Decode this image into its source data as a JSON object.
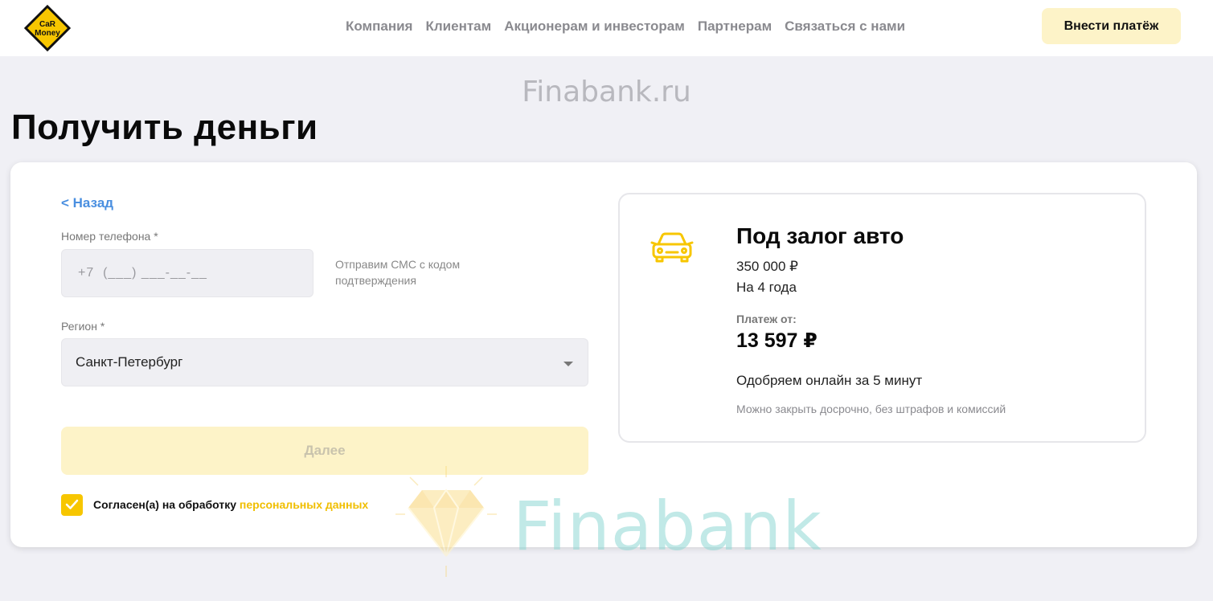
{
  "header": {
    "logo_text_line1": "CaR",
    "logo_text_line2": "Money",
    "nav": [
      "Компания",
      "Клиентам",
      "Акционерам и инвесторам",
      "Партнерам",
      "Связаться с нами"
    ],
    "pay_button": "Внести платёж"
  },
  "watermark": {
    "top_text": "Finabank.ru",
    "bottom_text": "Finabank"
  },
  "page": {
    "title": "Получить деньги"
  },
  "form": {
    "back_label": "< Назад",
    "phone_label": "Номер телефона *",
    "phone_placeholder": "+7  (___) ___-__-__",
    "sms_hint": "Отправим СМС с кодом подтверждения",
    "region_label": "Регион *",
    "region_value": "Санкт-Петербург",
    "next_button": "Далее",
    "consent_checked": true,
    "consent_text": "Согласен(а) на обработку ",
    "consent_link": "персональных данных"
  },
  "offer": {
    "icon": "car-icon",
    "title": "Под залог авто",
    "amount": "350 000 ₽",
    "term": "На 4 года",
    "payment_label": "Платеж от:",
    "payment_value": "13 597 ₽",
    "approve_text": "Одобряем онлайн за 5 минут",
    "close_note": "Можно закрыть досрочно, без штрафов и комиссий"
  },
  "colors": {
    "accent_yellow": "#f7c600",
    "button_yellow_light": "#fdf3c8",
    "link_blue": "#4a8fe0",
    "background": "#f0f0f5"
  }
}
